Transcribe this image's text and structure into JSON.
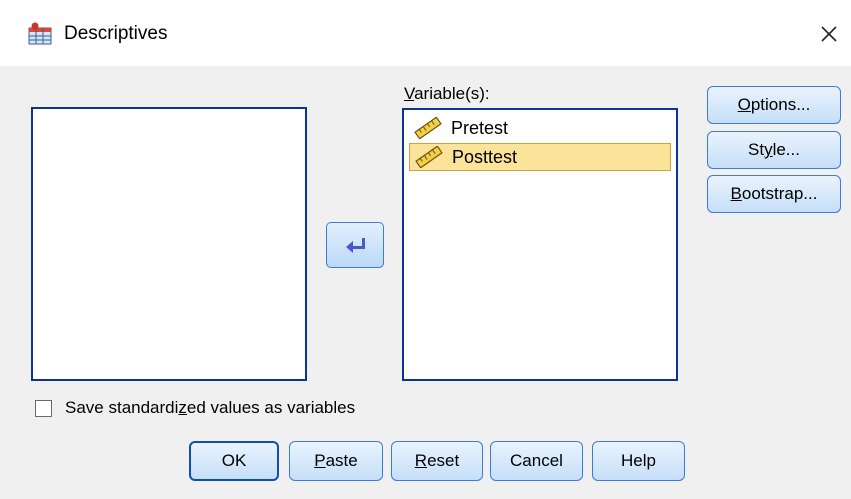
{
  "window": {
    "title": "Descriptives",
    "app_icon": "spss-table-icon",
    "close_icon": "close-icon"
  },
  "source_list": {
    "items": []
  },
  "variables": {
    "label": "Variable(s):",
    "items": [
      {
        "name": "Pretest",
        "icon": "ruler-icon",
        "selected": false
      },
      {
        "name": "Posttest",
        "icon": "ruler-icon",
        "selected": true
      }
    ]
  },
  "move_button": {
    "icon": "arrow-left-icon"
  },
  "side_buttons": {
    "options": "Options...",
    "style": "Style...",
    "bootstrap": "Bootstrap..."
  },
  "checkbox": {
    "label": "Save standardized values as variables",
    "checked": false
  },
  "buttons": {
    "ok": "OK",
    "paste": "Paste",
    "reset": "Reset",
    "cancel": "Cancel",
    "help": "Help"
  },
  "colors": {
    "accent_border": "#0d3393",
    "selection": "#fbe39a",
    "button_border": "#3b7bd9"
  }
}
